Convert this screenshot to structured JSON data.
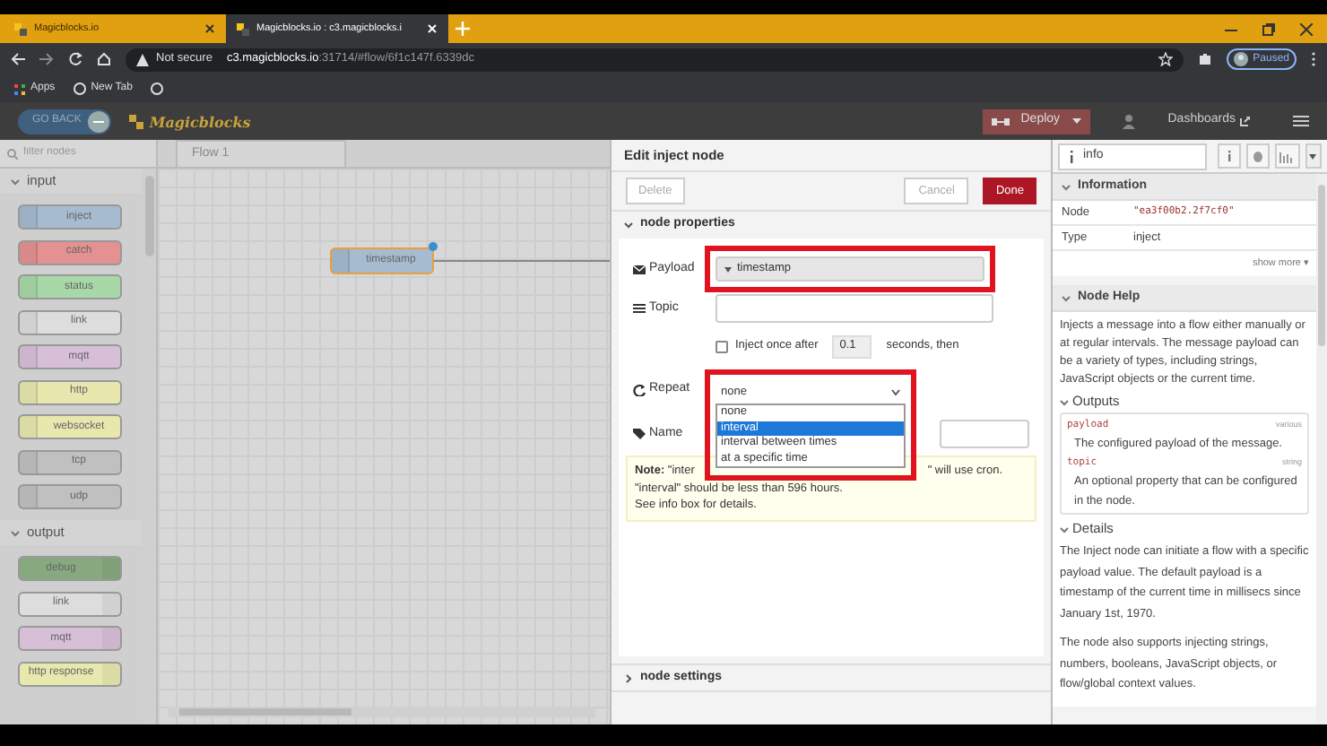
{
  "browser": {
    "tabs": [
      {
        "title": "Magicblocks.io",
        "selected": false
      },
      {
        "title": "Magicblocks.io : c3.magicblocks.i",
        "selected": true
      }
    ],
    "security": "Not secure",
    "url_host": "c3.magicblocks.io",
    "url_rest": ":31714/#flow/6f1c147f.6339dc",
    "profile": "Paused",
    "bookmarks": [
      "Apps",
      "New Tab"
    ]
  },
  "header": {
    "back": "GO BACK",
    "logo": "Magicblocks",
    "deploy": "Deploy",
    "dashboards": "Dashboards"
  },
  "palette": {
    "placeholder": "filter nodes",
    "categories": [
      {
        "name": "input",
        "expanded": true,
        "nodes": [
          {
            "label": "inject",
            "color": "#a6bbcf"
          },
          {
            "label": "catch",
            "color": "#e49191"
          },
          {
            "label": "status",
            "color": "#a8d8a8"
          },
          {
            "label": "link",
            "color": "#dddddd"
          },
          {
            "label": "mqtt",
            "color": "#d8bfd8"
          },
          {
            "label": "http",
            "color": "#e7e7ae"
          },
          {
            "label": "websocket",
            "color": "#e7e7ae"
          },
          {
            "label": "tcp",
            "color": "#c0c0c0"
          },
          {
            "label": "udp",
            "color": "#c0c0c0"
          }
        ]
      },
      {
        "name": "output",
        "expanded": true,
        "nodes": [
          {
            "label": "debug",
            "color": "#87a980"
          },
          {
            "label": "link",
            "color": "#dddddd"
          },
          {
            "label": "mqtt",
            "color": "#d8bfd8"
          },
          {
            "label": "http response",
            "color": "#e7e7ae"
          }
        ]
      }
    ]
  },
  "workspace": {
    "tab": "Flow 1",
    "node": {
      "label": "timestamp",
      "changed": true
    }
  },
  "editor": {
    "title": "Edit inject node",
    "delete": "Delete",
    "cancel": "Cancel",
    "done": "Done",
    "properties": {
      "title": "node properties",
      "expanded": true
    },
    "payload": {
      "label": "Payload",
      "value": "timestamp"
    },
    "topic": {
      "label": "Topic"
    },
    "inject_once": {
      "label": "Inject once after",
      "checked": false,
      "value": "0.1",
      "suffix": "seconds, then"
    },
    "repeat": {
      "label": "Repeat",
      "value": "none",
      "options": [
        {
          "label": "none",
          "highlighted": false
        },
        {
          "label": "interval",
          "highlighted": true
        },
        {
          "label": "interval between times",
          "highlighted": false
        },
        {
          "label": "at a specific time",
          "highlighted": false
        }
      ]
    },
    "name": {
      "label": "Name"
    },
    "note": {
      "bold": "Note:",
      "start": "\"inter",
      "end": "\" will use cron.",
      "lines": [
        "\"interval\" should be less than 596 hours.",
        "See info box for details."
      ]
    },
    "settings": {
      "title": "node settings",
      "expanded": false
    }
  },
  "info": {
    "tab": "info",
    "information": "Information",
    "rows": [
      {
        "key": "Node",
        "value": "\"ea3f00b2.2f7cf0\"",
        "kind": "code"
      },
      {
        "key": "Type",
        "value": "inject",
        "kind": "text"
      }
    ],
    "show_more": "show more ▾",
    "help_title": "Node Help",
    "help": "Injects a message into a flow either manually or at regular intervals. The message payload can be a variety of types, including strings, JavaScript objects or the current time.",
    "outputs_title": "Outputs",
    "outputs": [
      {
        "name": "payload",
        "type": "various",
        "desc": "The configured payload of the message."
      },
      {
        "name": "topic",
        "type": "string",
        "desc": "An optional property that can be configured in the node."
      }
    ],
    "details_title": "Details",
    "details": [
      "The Inject node can initiate a flow with a specific payload value. The default payload is a timestamp of the current time in millisecs since January 1st, 1970.",
      "The node also supports injecting strings, numbers, booleans, JavaScript objects, or flow/global context values."
    ]
  }
}
